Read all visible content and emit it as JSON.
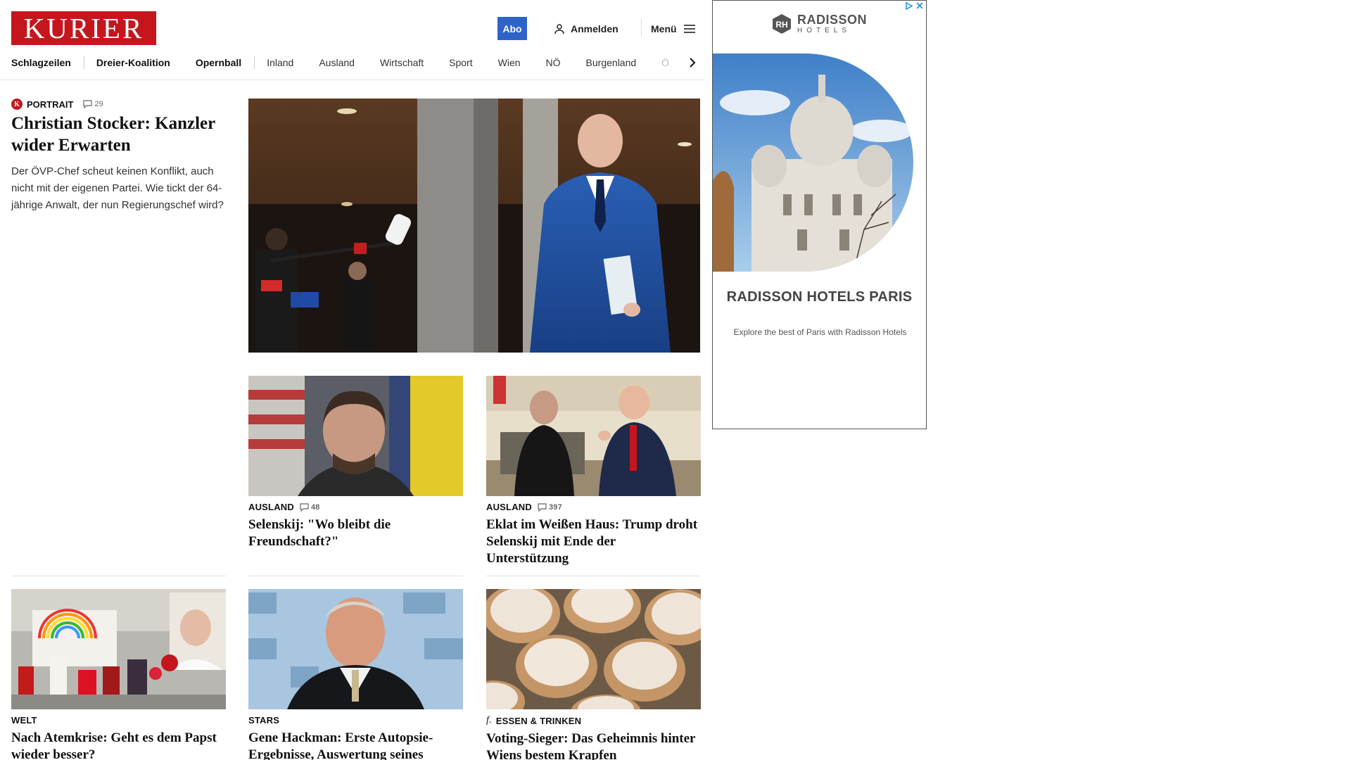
{
  "header": {
    "logo": "KURIER",
    "abo_label": "Abo",
    "login_label": "Anmelden",
    "menu_label": "Menü"
  },
  "nav": {
    "items": [
      "Schlagzeilen",
      "Dreier-Koalition",
      "Opernball",
      "Inland",
      "Ausland",
      "Wirtschaft",
      "Sport",
      "Wien",
      "NÖ",
      "Burgenland",
      "Ö"
    ]
  },
  "lead": {
    "category": "PORTRAIT",
    "comments": "29",
    "title": "Christian Stocker: Kanzler wider Erwarten",
    "teaser": "Der ÖVP-Chef scheut keinen Konflikt, auch nicht mit der eigenen Partei. Wie tickt der 64-jährige Anwalt, der nun Regierungschef wird?"
  },
  "cards": [
    {
      "category": "AUSLAND",
      "comments": "48",
      "title": "Selenskij: \"Wo bleibt die Freundschaft?\""
    },
    {
      "category": "AUSLAND",
      "comments": "397",
      "title": "Eklat im Weißen Haus: Trump droht Selenskij mit Ende der Unterstützung"
    },
    {
      "category": "WELT",
      "comments": "",
      "title": "Nach Atemkrise: Geht es dem Papst wieder besser?"
    },
    {
      "category": "STARS",
      "comments": "",
      "title": "Gene Hackman: Erste Autopsie-Ergebnisse, Auswertung seines Herzschrittmachers sind da"
    },
    {
      "category": "ESSEN & TRINKEN",
      "comments": "",
      "title": "Voting-Sieger: Das Geheimnis hinter Wiens bestem Krapfen"
    }
  ],
  "ad": {
    "brand_name": "RADISSON",
    "brand_sub": "HOTELS",
    "title": "RADISSON HOTELS PARIS",
    "description": "Explore the best of Paris with Radisson Hotels"
  },
  "colors": {
    "brand_red": "#c4161c",
    "abo_blue": "#2e64c8"
  }
}
